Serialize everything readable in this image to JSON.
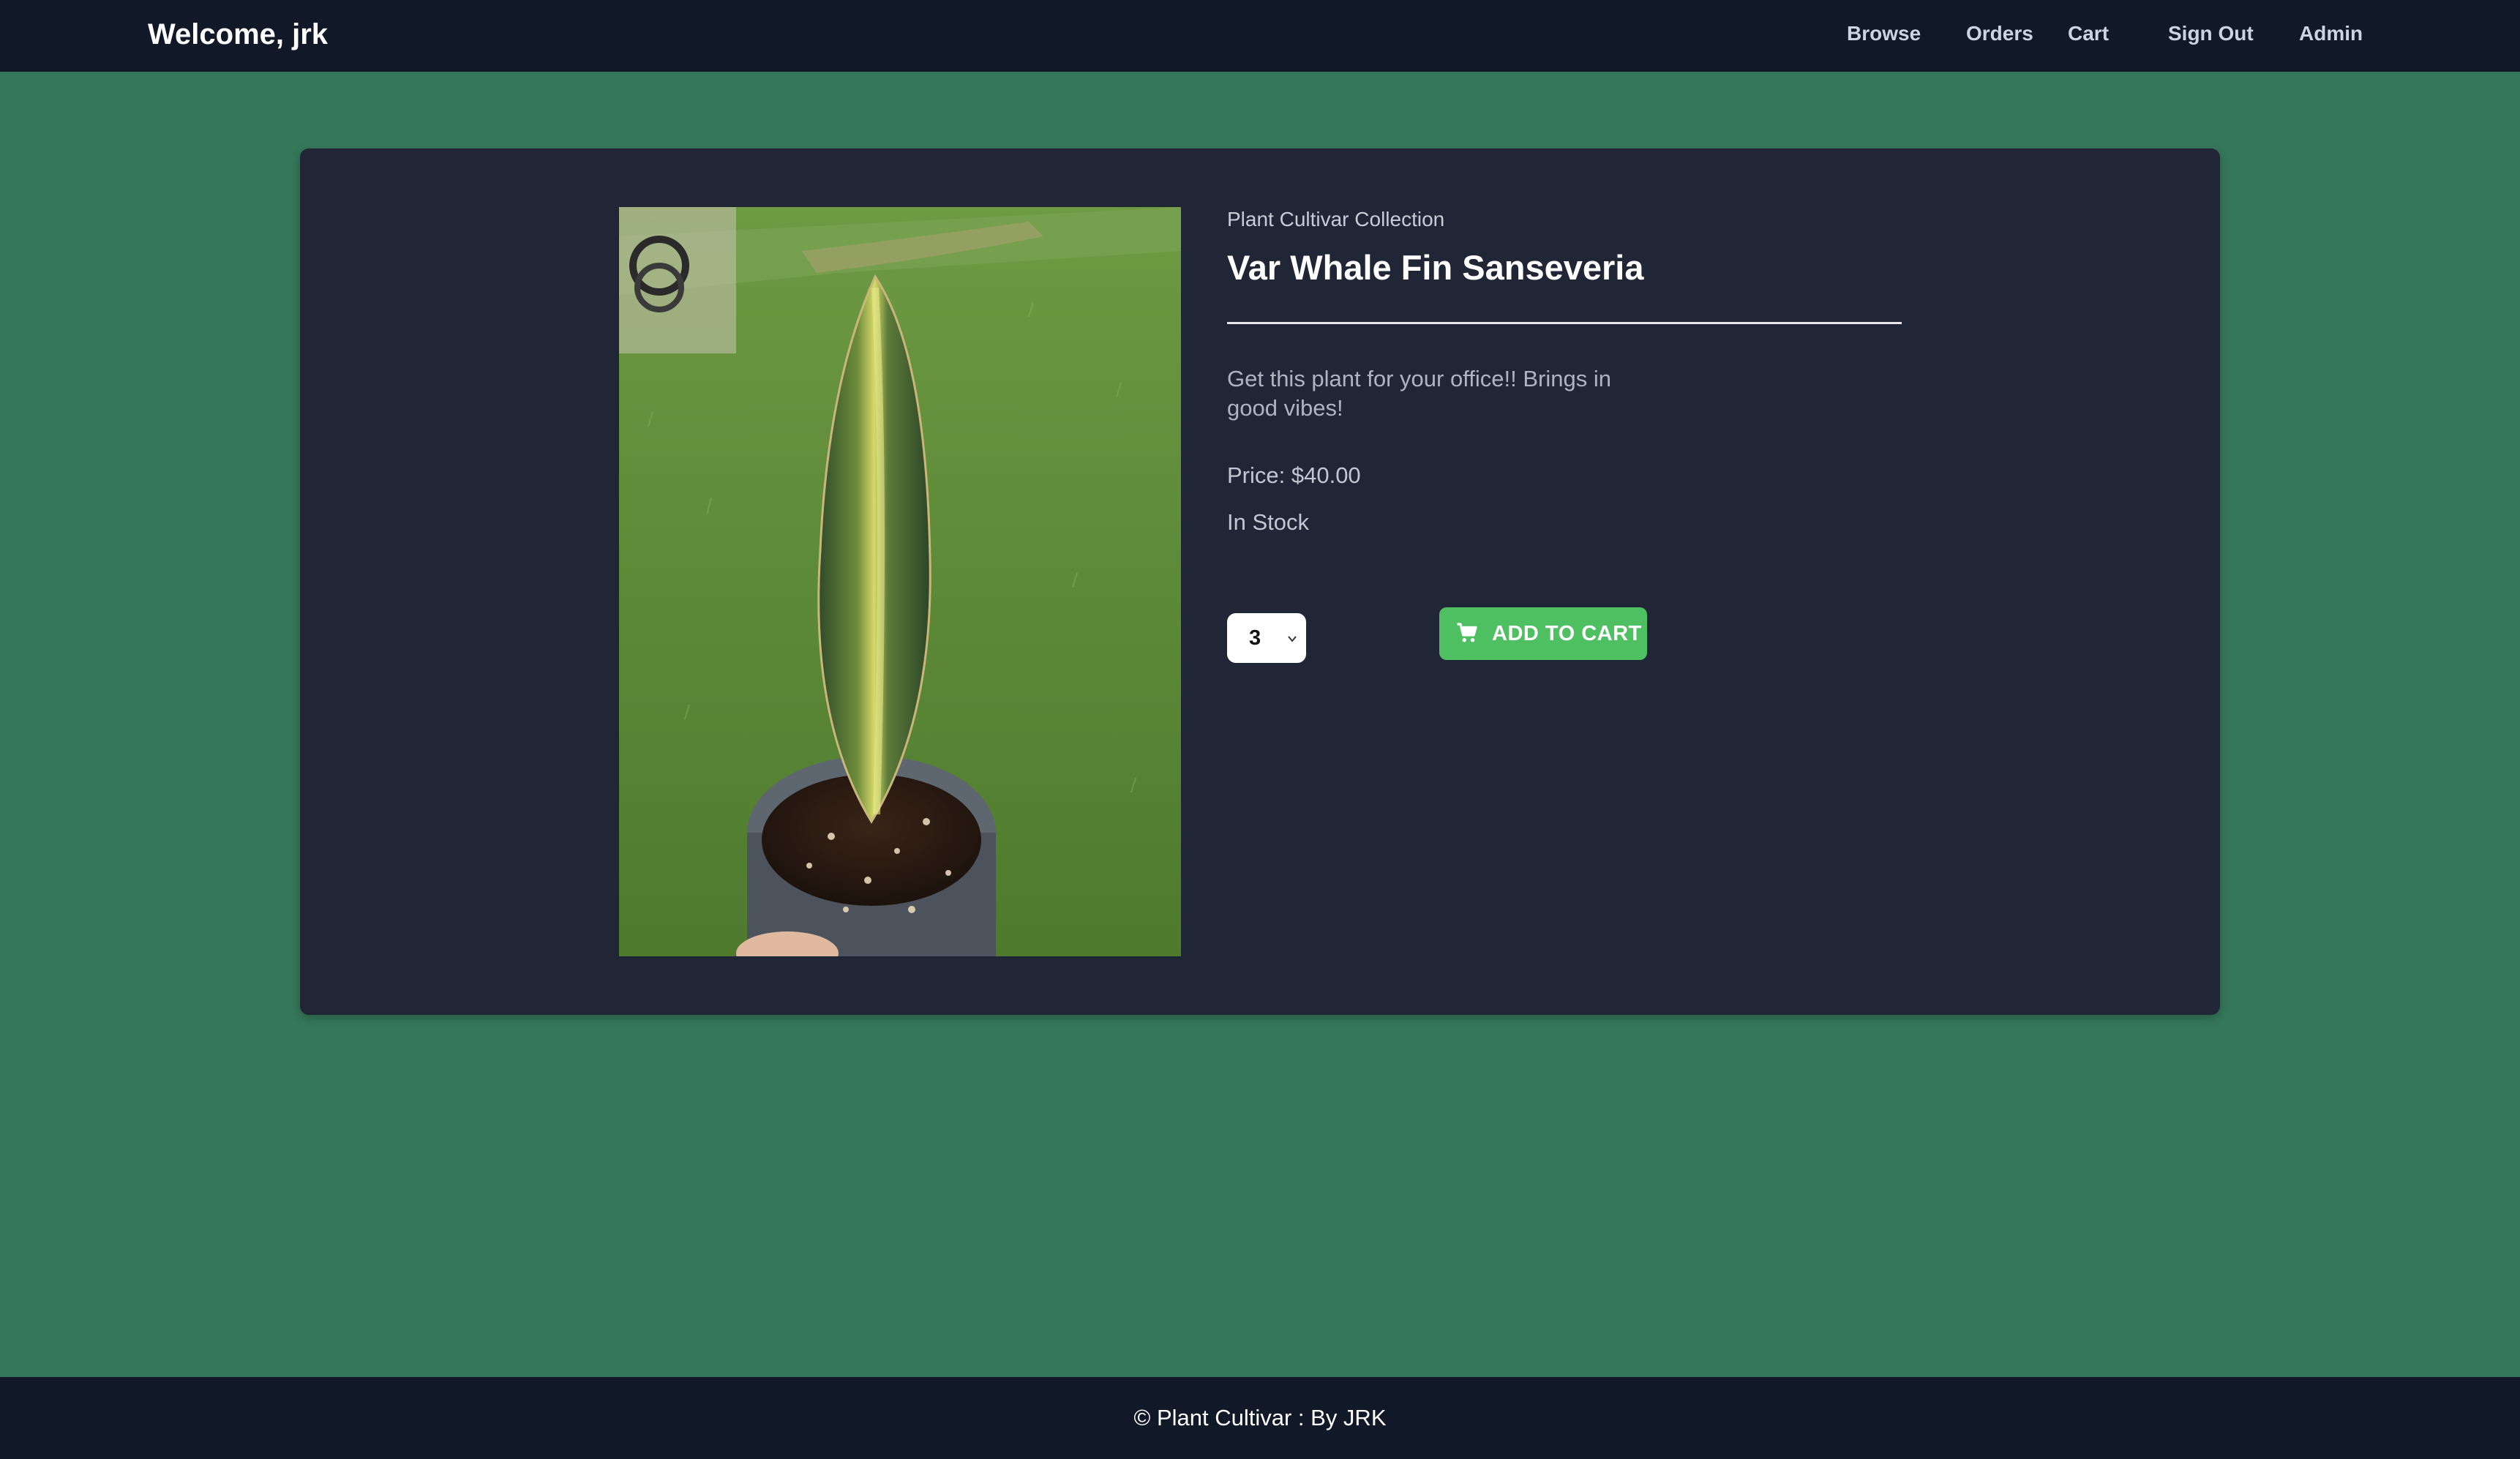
{
  "header": {
    "welcome": "Welcome, jrk",
    "nav": {
      "browse": "Browse",
      "orders": "Orders",
      "cart": "Cart",
      "sign_out": "Sign Out",
      "admin": "Admin"
    }
  },
  "product": {
    "collection": "Plant Cultivar Collection",
    "name": "Var Whale Fin Sanseveria",
    "description": "Get this plant for your office!! Brings in good vibes!",
    "price": "Price: $40.00",
    "stock": "In Stock",
    "quantity": "3",
    "add_to_cart": "ADD TO CART",
    "image_icon": "plant-photo"
  },
  "footer": {
    "text": "© Plant Cultivar : By JRK"
  },
  "colors": {
    "page_bg": "#35775a",
    "nav_bg": "#111827",
    "card_bg": "#212636",
    "button": "#4fc062"
  }
}
